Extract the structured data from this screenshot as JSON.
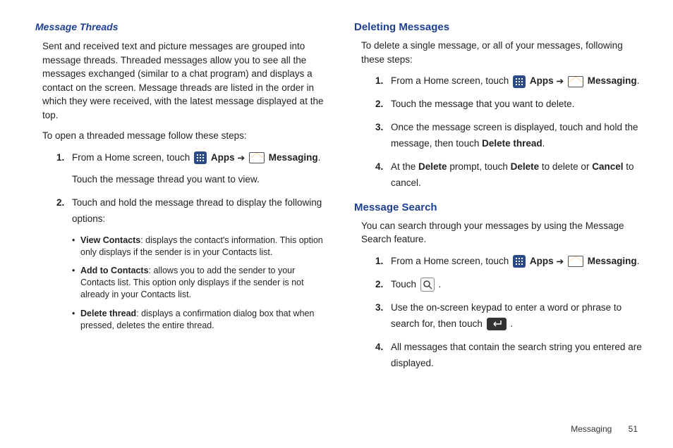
{
  "left": {
    "heading": "Message Threads",
    "p1": "Sent and received text and picture messages are grouped into message threads. Threaded messages allow you to see all the messages exchanged (similar to a chat program) and displays a contact on the screen. Message threads are listed in the order in which they were received, with the latest message displayed at the top.",
    "p2": "To open a threaded message follow these steps:",
    "step1_pre": "From a Home screen, touch ",
    "apps_label": "Apps",
    "arrow": "➔",
    "messaging_label": "Messaging",
    "period": ".",
    "step1_sub": "Touch the message thread you want to view.",
    "step2": "Touch and hold the message thread to display the following options:",
    "b1_bold": "View Contacts",
    "b1_text": ": displays the contact's information. This option only displays if the sender is in your Contacts list.",
    "b2_bold": "Add to Contacts",
    "b2_text": ": allows you to add the sender to your Contacts list. This option only displays if the sender is not already in your Contacts list.",
    "b3_bold": "Delete thread",
    "b3_text": ": displays a confirmation dialog box that when pressed, deletes the entire thread."
  },
  "right": {
    "del_heading": "Deleting Messages",
    "del_p1": "To delete a single message, or all of your messages, following these steps:",
    "del_s1_pre": "From a Home screen, touch ",
    "del_s2": "Touch the message that you want to delete.",
    "del_s3_a": "Once the message screen is displayed, touch and hold the message, then touch ",
    "del_s3_b": "Delete thread",
    "del_s3_c": ".",
    "del_s4_a": "At the ",
    "del_s4_b": "Delete",
    "del_s4_c": " prompt, touch ",
    "del_s4_d": "Delete",
    "del_s4_e": " to delete or ",
    "del_s4_f": "Cancel",
    "del_s4_g": " to cancel.",
    "search_heading": "Message Search",
    "search_p1": "You can search through your messages by using the Message Search feature.",
    "search_s1_pre": "From a Home screen, touch ",
    "search_s2_a": "Touch ",
    "search_s2_b": ".",
    "search_s3_a": "Use the on-screen keypad to enter a word or phrase to search for, then touch ",
    "search_s3_b": ".",
    "search_s4": "All messages that contain the search string you entered are displayed."
  },
  "footer": {
    "section": "Messaging",
    "page": "51"
  }
}
